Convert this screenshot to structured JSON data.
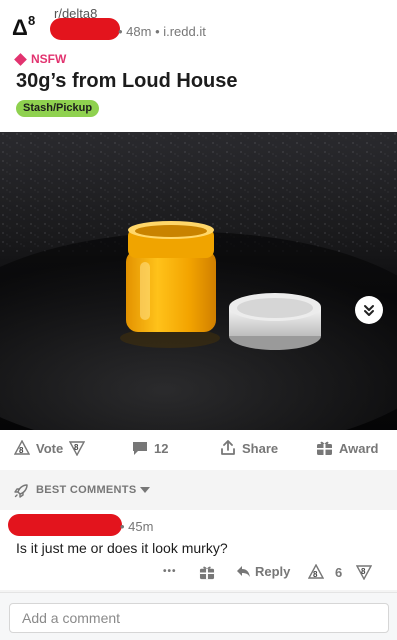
{
  "post": {
    "subreddit": "r/delta8",
    "subreddit_icon_text": "Δ8",
    "meta": "• 48m • i.redd.it",
    "nsfw_label": "NSFW",
    "title": "30g’s from Loud House",
    "flair": "Stash/Pickup",
    "flair_color": "#8fd14f"
  },
  "actions": {
    "vote_label": "Vote",
    "comments_count": "12",
    "share_label": "Share",
    "award_label": "Award"
  },
  "comments_section": {
    "sort_label": "BEST COMMENTS"
  },
  "comment": {
    "meta": "• 45m",
    "text": "Is it just me or does it look murky?",
    "more_label": "•••",
    "reply_label": "Reply",
    "score": "6"
  },
  "composer": {
    "placeholder": "Add a comment"
  },
  "colors": {
    "nsfw": "#e2336f",
    "redaction": "#e3141d",
    "secondary_text": "#777777"
  }
}
